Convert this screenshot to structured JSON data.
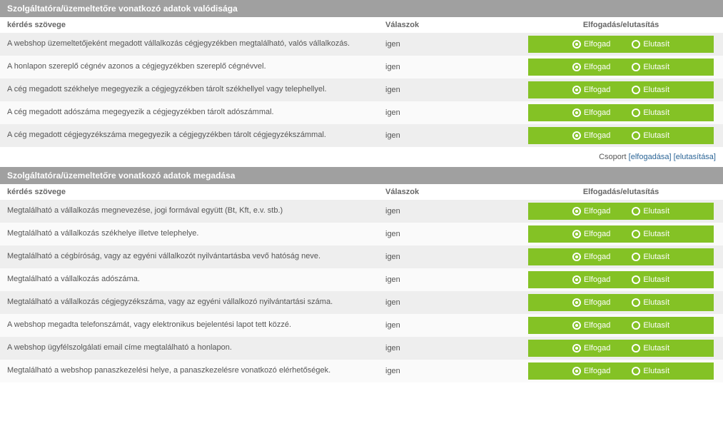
{
  "headers": {
    "question": "kérdés szövege",
    "answers": "Válaszok",
    "decision": "Elfogadás/elutasítás"
  },
  "labels": {
    "accept": "Elfogad",
    "reject": "Elutasít",
    "group": "Csoport",
    "group_accept": "[elfogadása]",
    "group_reject": "[elutasítása]"
  },
  "sections": [
    {
      "title": "Szolgáltatóra/üzemeltetőre vonatkozó adatok valódisága",
      "rows": [
        {
          "q": "A webshop üzemeltetőjeként megadott vállalkozás cégjegyzékben megtalálható, valós vállalkozás.",
          "a": "igen"
        },
        {
          "q": "A honlapon szereplő cégnév azonos a cégjegyzékben szereplő cégnévvel.",
          "a": "igen"
        },
        {
          "q": "A cég megadott székhelye megegyezik a cégjegyzékben tárolt székhellyel vagy telephellyel.",
          "a": "igen"
        },
        {
          "q": "A cég megadott adószáma megegyezik a cégjegyzékben tárolt adószámmal.",
          "a": "igen"
        },
        {
          "q": "A cég megadott cégjegyzékszáma megegyezik a cégjegyzékben tárolt cégjegyzékszámmal.",
          "a": "igen"
        }
      ]
    },
    {
      "title": "Szolgáltatóra/üzemeltetőre vonatkozó adatok megadása",
      "rows": [
        {
          "q": "Megtalálható a vállalkozás megnevezése, jogi formával együtt (Bt, Kft, e.v. stb.)",
          "a": "igen"
        },
        {
          "q": "Megtalálható a vállalkozás székhelye illetve telephelye.",
          "a": "igen"
        },
        {
          "q": "Megtalálható a cégbíróság, vagy az egyéni vállalkozót nyilvántartásba vevő hatóság neve.",
          "a": "igen"
        },
        {
          "q": "Megtalálható a vállalkozás adószáma.",
          "a": "igen"
        },
        {
          "q": "Megtalálható a vállalkozás cégjegyzékszáma, vagy az egyéni vállalkozó nyilvántartási száma.",
          "a": "igen"
        },
        {
          "q": "A webshop megadta telefonszámát, vagy elektronikus bejelentési lapot tett közzé.",
          "a": "igen"
        },
        {
          "q": "A webshop ügyfélszolgálati email címe megtalálható a honlapon.",
          "a": "igen"
        },
        {
          "q": "Megtalálható a webshop panaszkezelési helye, a panaszkezelésre vonatkozó elérhetőségek.",
          "a": "igen"
        }
      ]
    }
  ]
}
